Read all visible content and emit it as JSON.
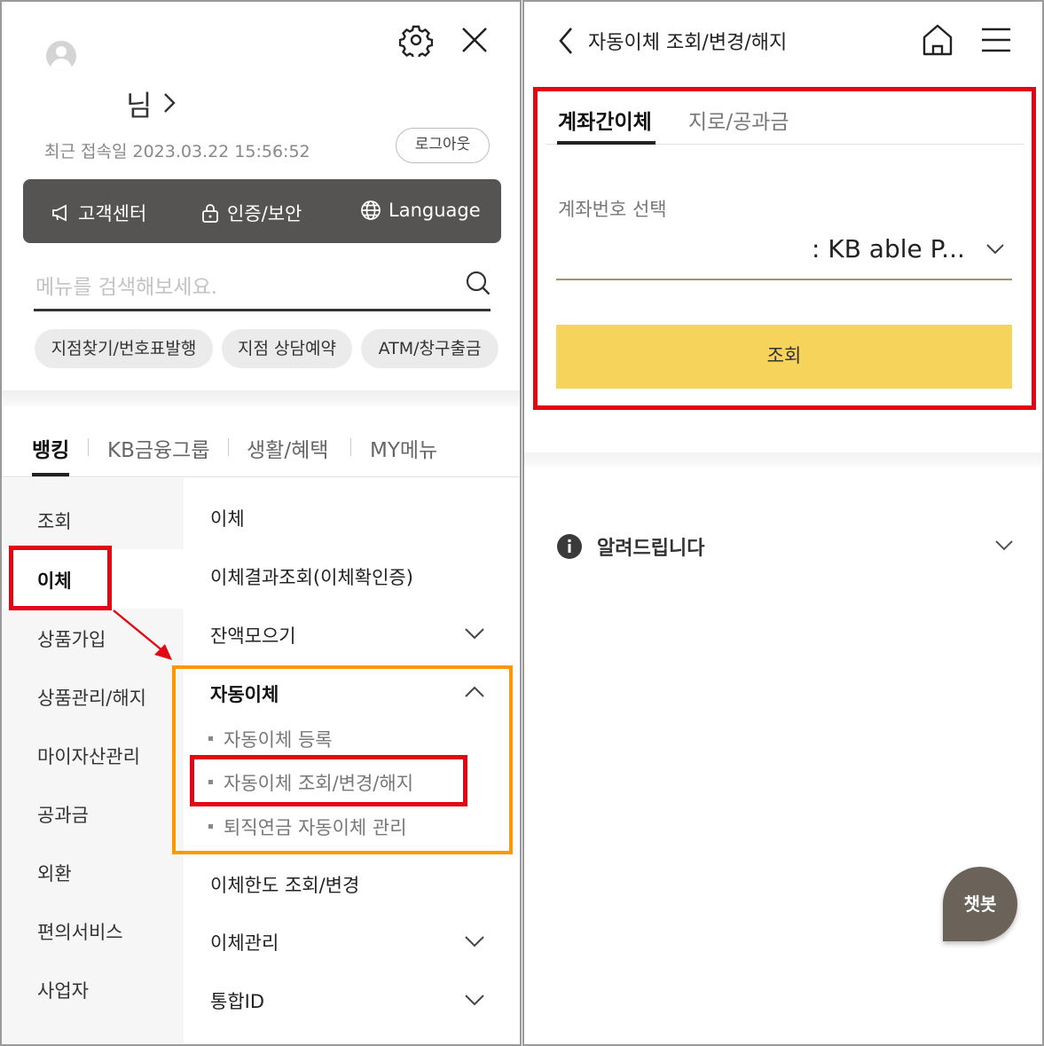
{
  "left": {
    "user": {
      "name_suffix": "님",
      "last_login": "최근 접속일 2023.03.22 15:56:52",
      "logout_label": "로그아웃"
    },
    "quick_links": [
      {
        "label": "고객센터",
        "icon": "megaphone-icon"
      },
      {
        "label": "인증/보안",
        "icon": "lock-icon"
      },
      {
        "label": "Language",
        "icon": "globe-icon"
      }
    ],
    "search": {
      "placeholder": "메뉴를 검색해보세요."
    },
    "chips": [
      "지점찾기/번호표발행",
      "지점 상담예약",
      "ATM/창구출금"
    ],
    "tabs": [
      "뱅킹",
      "KB금융그룹",
      "생활/혜택",
      "MY메뉴"
    ],
    "side_menu": [
      "조회",
      "이체",
      "상품가입",
      "상품관리/해지",
      "마이자산관리",
      "공과금",
      "외환",
      "편의서비스",
      "사업자"
    ],
    "sub_menu": {
      "transfer": "이체",
      "transfer_result": "이체결과조회(이체확인증)",
      "balance_collect": "잔액모으기",
      "auto_transfer": "자동이체",
      "auto_items": [
        "자동이체 등록",
        "자동이체 조회/변경/해지",
        "퇴직연금 자동이체 관리"
      ],
      "limit": "이체한도 조회/변경",
      "manage": "이체관리",
      "integrated_id": "통합ID"
    }
  },
  "right": {
    "title": "자동이체 조회/변경/해지",
    "tabs": [
      "계좌간이체",
      "지로/공과금"
    ],
    "account_label": "계좌번호 선택",
    "account_value": ": KB able P...",
    "query_button": "조회",
    "notice": "알려드립니다",
    "chatbot": "챗봇"
  },
  "colors": {
    "highlight_red": "#e30613",
    "highlight_orange": "#ff9800",
    "query_yellow": "#f6d35a",
    "quickbar": "#555452"
  }
}
